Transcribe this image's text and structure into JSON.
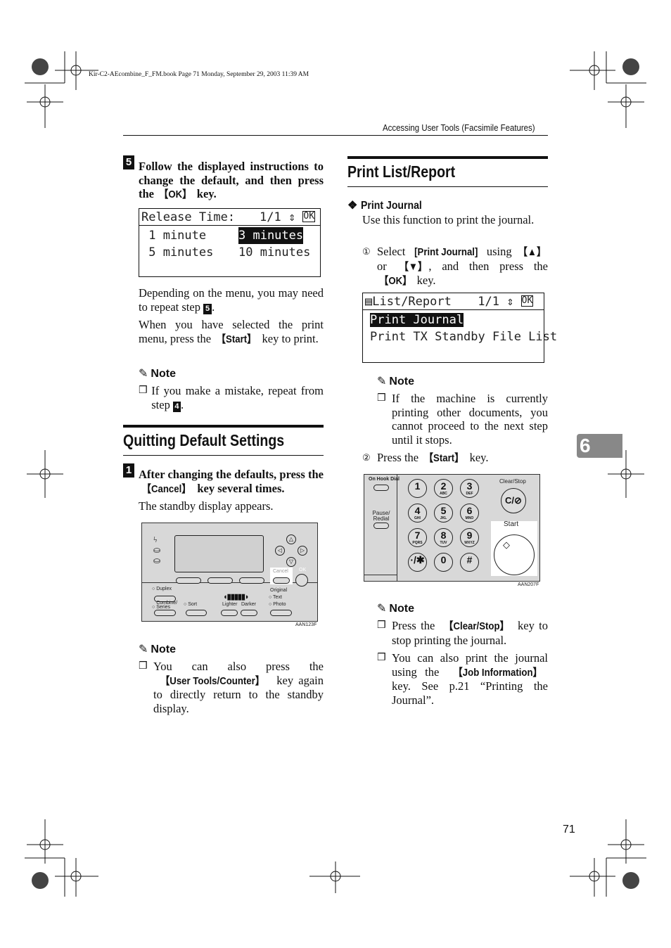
{
  "print_header": "Kir-C2-AEcombine_F_FM.book  Page 71  Monday, September 29, 2003  11:39 AM",
  "running_head": "Accessing User Tools (Facsimile Features)",
  "chapter_tab": "6",
  "page_number": "71",
  "left": {
    "step5": {
      "num": "5",
      "text_a": "Follow the displayed instructions to change the default, and then press the ",
      "key": "【OK】",
      "text_b": " key."
    },
    "lcd1": {
      "rows": [
        {
          "a": "Release Time:",
          "b": "1/1 ⇕ ",
          "c": "OK"
        },
        {
          "a": " 1 minute",
          "b": "3 minutes"
        },
        {
          "a": " 5 minutes",
          "b": "10 minutes"
        }
      ]
    },
    "para1_a": "Depending on the menu, you may need to repeat step ",
    "para1_step": "5",
    "para1_b": ".",
    "para2_a": "When you have selected the print menu, press the ",
    "para2_key": "【Start】",
    "para2_b": " key to print.",
    "note1": {
      "title": "Note",
      "text_a": "If you make a mistake, repeat from step ",
      "step": "4",
      "text_b": "."
    },
    "section_title": "Quitting Default Settings",
    "step1": {
      "num": "1",
      "text_a": "After changing the defaults, press the ",
      "key": "【Cancel】",
      "text_b": " key several times."
    },
    "para3": "The standby display appears.",
    "panel": {
      "labels": {
        "cancel": "Cancel",
        "ok": "OK",
        "duplex": "Duplex",
        "combine": "Combine/ Series",
        "sort": "Sort",
        "lighter": "Lighter",
        "darker": "Darker",
        "original": "Original",
        "text": "Text",
        "photo": "Photo"
      },
      "code": "AAN123F"
    },
    "note2": {
      "title": "Note",
      "text_a": "You can also press the ",
      "key": "【User Tools/Counter】",
      "text_b": " key again to directly return to the standby display."
    }
  },
  "right": {
    "section_title": "Print List/Report",
    "subhead": "Print Journal",
    "intro": "Use this function to print the journal.",
    "sub1": {
      "num": "①",
      "text_a": "Select ",
      "item": "[Print Journal]",
      "text_b": " using ",
      "key1": "【▲】",
      "text_c": " or ",
      "key2": "【▼】",
      "text_d": ", and then press the ",
      "key3": "【OK】",
      "text_e": " key."
    },
    "lcd2": {
      "rows": [
        {
          "a": "List/Report",
          "b": "1/1 ⇕ ",
          "c": "OK"
        },
        {
          "a": "Print Journal"
        },
        {
          "a": "Print TX Standby File List"
        }
      ]
    },
    "note3": {
      "title": "Note",
      "text": "If the machine is currently printing other documents, you cannot proceed to the next step until it stops."
    },
    "sub2": {
      "num": "②",
      "text_a": "Press the ",
      "key": "【Start】",
      "text_b": " key."
    },
    "keypad": {
      "on_hook": "On Hook Dial",
      "pause": "Pause/ Redial",
      "clear_stop": "Clear/Stop",
      "start": "Start",
      "code": "AAN207F",
      "keys": [
        [
          "1",
          ""
        ],
        [
          "2",
          "ABC"
        ],
        [
          "3",
          "DEF"
        ],
        [
          "4",
          "GHI"
        ],
        [
          "5",
          "JKL"
        ],
        [
          "6",
          "MNO"
        ],
        [
          "7",
          "PQRS"
        ],
        [
          "8",
          "TUV"
        ],
        [
          "9",
          "WXYZ"
        ],
        [
          "·/✱",
          ""
        ],
        [
          "0",
          ""
        ],
        [
          "#",
          ""
        ]
      ]
    },
    "note4": {
      "title": "Note",
      "item1_a": "Press the ",
      "item1_key": "【Clear/Stop】",
      "item1_b": " key to stop printing the journal.",
      "item2_a": "You can also print the journal using the ",
      "item2_key": "【Job Information】",
      "item2_b": " key. See p.21 “Printing the Journal”."
    }
  }
}
